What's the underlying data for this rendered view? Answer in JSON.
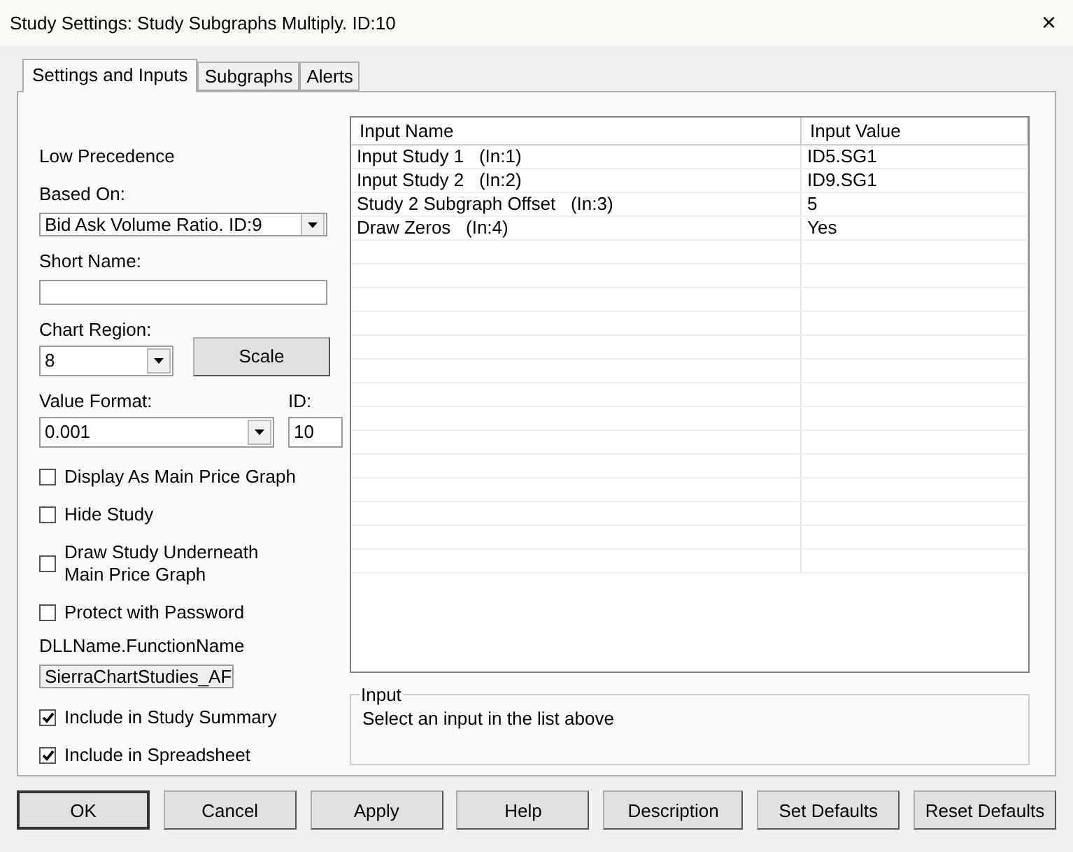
{
  "window": {
    "title": "Study Settings: Study Subgraphs Multiply. ID:10",
    "close": "×"
  },
  "tabs": [
    {
      "label": "Settings and Inputs",
      "selected": true
    },
    {
      "label": "Subgraphs",
      "selected": false
    },
    {
      "label": "Alerts",
      "selected": false
    }
  ],
  "settings": {
    "precedence": "Low Precedence",
    "based_on": {
      "label": "Based On:",
      "value": "Bid Ask Volume Ratio. ID:9"
    },
    "short_name": {
      "label": "Short Name:"
    },
    "chart_region": {
      "label": "Chart Region:",
      "value": "8"
    },
    "scale_button": "Scale",
    "value_format": {
      "label": "Value Format:",
      "value": "0.001"
    },
    "id": {
      "label": "ID:",
      "value": "10"
    },
    "options": [
      {
        "label": "Display As Main Price Graph",
        "checked": false
      },
      {
        "label": "Hide Study",
        "checked": false
      },
      {
        "label": "Draw Study Underneath\nMain Price Graph",
        "checked": false
      },
      {
        "label": "Protect with Password",
        "checked": false
      }
    ],
    "dll": {
      "label": "DLLName.FunctionName",
      "value": "SierraChartStudies_AF"
    },
    "includes": [
      {
        "label": "Include in Study Summary",
        "checked": true
      },
      {
        "label": "Include in Spreadsheet",
        "checked": true
      }
    ]
  },
  "table": {
    "columns": [
      "Input Name",
      "Input Value"
    ],
    "rows": [
      {
        "name": "Input Study 1   (In:1)",
        "value": "ID5.SG1"
      },
      {
        "name": "Input Study 2   (In:2)",
        "value": "ID9.SG1"
      },
      {
        "name": "Study 2 Subgraph Offset   (In:3)",
        "value": "5"
      },
      {
        "name": "Draw Zeros   (In:4)",
        "value": "Yes"
      }
    ]
  },
  "input_box": {
    "title": "Input",
    "text": "Select an input in the list above"
  },
  "buttons": [
    "OK",
    "Cancel",
    "Apply",
    "Help",
    "Description",
    "Set Defaults",
    "Reset Defaults"
  ]
}
